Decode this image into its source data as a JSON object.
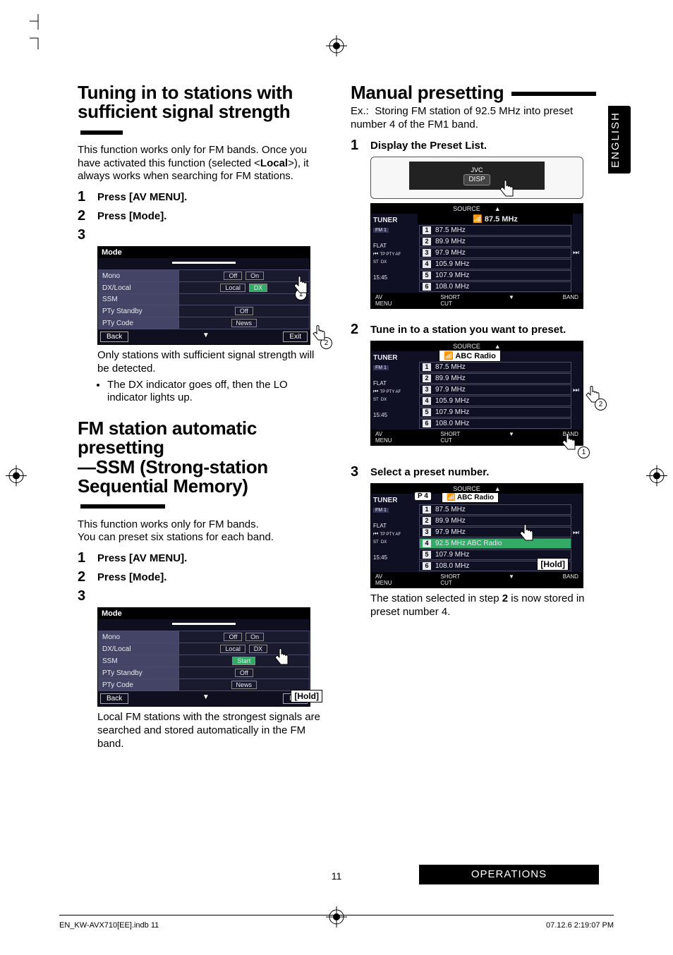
{
  "lang_tab": "ENGLISH",
  "section_bar": "OPERATIONS",
  "page_number": "11",
  "footer_left": "EN_KW-AVX710[EE].indb   11",
  "footer_right": "07.12.6   2:19:07 PM",
  "left": {
    "h1_line1": "Tuning in to stations with",
    "h1_line2": "sufficient signal strength",
    "intro": "This function works only for FM bands. Once you have activated this function (selected <Local>), it always works when searching for FM stations.",
    "intro_pre": "This function works only for FM bands. Once you have activated this function (selected <",
    "intro_bold": "Local",
    "intro_post": ">), it always works when searching for FM stations.",
    "step1": "Press [AV MENU].",
    "step2": "Press [Mode].",
    "caption1": "Only stations with sufficient signal strength will be detected.",
    "bullet1": "The DX indicator goes off, then the LO indicator lights up.",
    "h2_line1": "FM station automatic presetting",
    "h2_line2": "—SSM (Strong-station",
    "h2_line3": "Sequential Memory)",
    "intro2a": "This function works only for FM bands.",
    "intro2b": "You can preset six stations for each band.",
    "step1b": "Press [AV MENU].",
    "step2b": "Press [Mode].",
    "caption2": "Local FM stations with the strongest signals are searched and stored automatically in the FM band.",
    "hold_label": "[Hold]"
  },
  "right": {
    "h1": "Manual presetting",
    "ex_lead": "Ex.:",
    "ex_body": "Storing FM station of 92.5 MHz into preset number 4 of the FM1 band.",
    "step1": "Display the Preset List.",
    "step2": "Tune in to a station you want to preset.",
    "step3": "Select a preset number.",
    "conclusion_pre": "The station selected in step ",
    "conclusion_num": "2",
    "conclusion_post": " is now stored in preset number 4.",
    "hold_label": "[Hold]",
    "disp_btn": "DISP",
    "brand": "JVC"
  },
  "mode_table": {
    "title": "Mode",
    "rows": [
      {
        "lbl": "Mono",
        "a": "Off",
        "b": "On"
      },
      {
        "lbl": "DX/Local",
        "a": "Local",
        "b": "DX"
      },
      {
        "lbl": "SSM",
        "a": "",
        "b": ""
      },
      {
        "lbl": "PTy Standby",
        "a": "Off",
        "b": ""
      },
      {
        "lbl": "PTy Code",
        "a": "News",
        "b": ""
      }
    ],
    "back": "Back",
    "exit": "Exit",
    "start": "Start"
  },
  "tuner1": {
    "source": "SOURCE",
    "title": "TUNER",
    "band": "FM 1",
    "flat": "FLAT",
    "flags": "TP PTY AF\nST  DX",
    "time": "15:45",
    "current": "87.5 MHz",
    "list": [
      {
        "i": "1",
        "f": "87.5 MHz"
      },
      {
        "i": "2",
        "f": "89.9 MHz"
      },
      {
        "i": "3",
        "f": "97.9 MHz"
      },
      {
        "i": "4",
        "f": "105.9 MHz"
      },
      {
        "i": "5",
        "f": "107.9 MHz"
      },
      {
        "i": "6",
        "f": "108.0 MHz"
      }
    ],
    "menu": "AV\nMENU",
    "short": "SHORT\nCUT",
    "bandbtn": "BAND"
  },
  "tuner2": {
    "source": "SOURCE",
    "title": "TUNER",
    "band": "FM 1",
    "flat": "FLAT",
    "flags": "TP PTY AF\nST  DX",
    "time": "15:45",
    "station": "ABC Radio",
    "list": [
      {
        "i": "1",
        "f": "87.5 MHz"
      },
      {
        "i": "2",
        "f": "89.9 MHz"
      },
      {
        "i": "3",
        "f": "97.9 MHz"
      },
      {
        "i": "4",
        "f": "105.9 MHz"
      },
      {
        "i": "5",
        "f": "107.9 MHz"
      },
      {
        "i": "6",
        "f": "108.0 MHz"
      }
    ],
    "menu": "AV\nMENU",
    "short": "SHORT\nCUT",
    "bandbtn": "BAND"
  },
  "tuner3": {
    "source": "SOURCE",
    "title": "TUNER",
    "band": "FM 1",
    "flat": "FLAT",
    "flags": "TP PTY AF\nST  DX",
    "time": "15:45",
    "station": "ABC Radio",
    "preset": "P 4",
    "list": [
      {
        "i": "1",
        "f": "87.5 MHz"
      },
      {
        "i": "2",
        "f": "89.9 MHz"
      },
      {
        "i": "3",
        "f": "97.9 MHz"
      },
      {
        "i": "4",
        "f": "92.5 MHz  ABC Radio"
      },
      {
        "i": "5",
        "f": "107.9 MHz"
      },
      {
        "i": "6",
        "f": "108.0 MHz"
      }
    ],
    "menu": "AV\nMENU",
    "short": "SHORT\nCUT",
    "bandbtn": "BAND"
  },
  "callouts": {
    "one": "1",
    "two": "2"
  }
}
